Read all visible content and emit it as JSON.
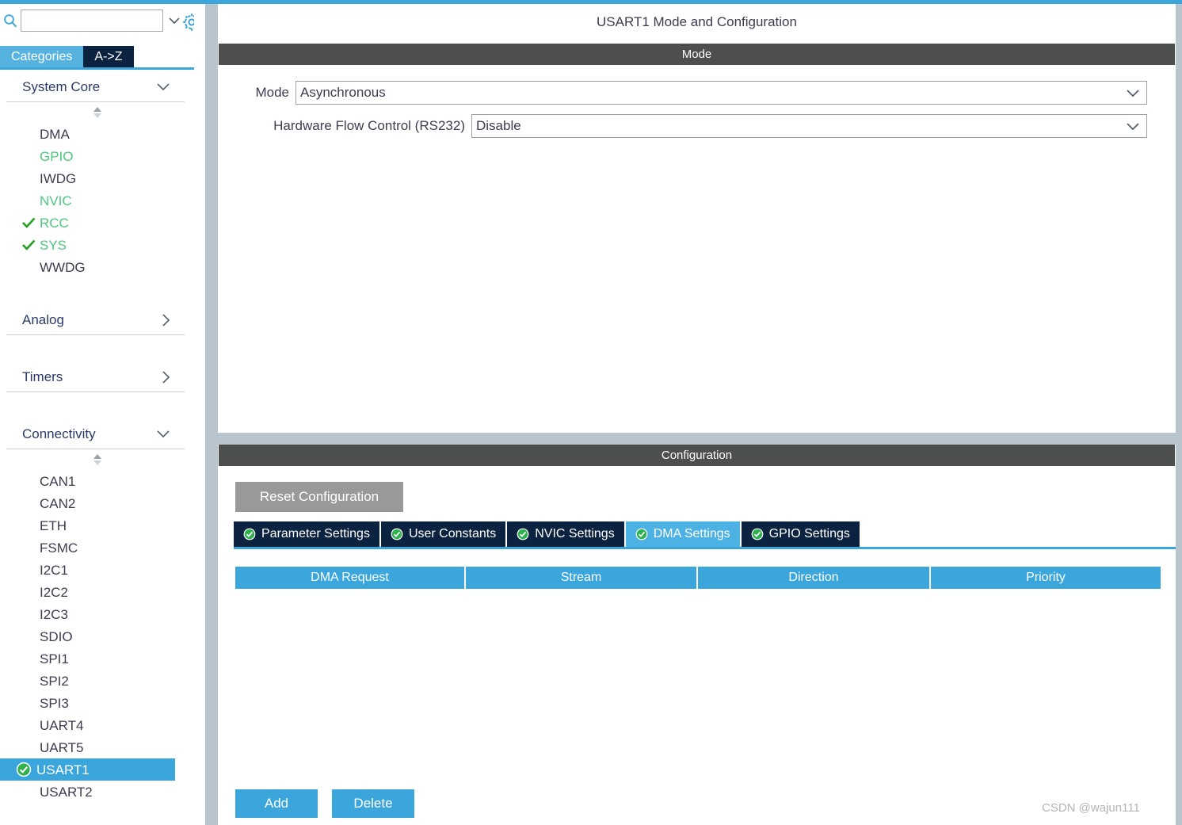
{
  "theme": {
    "accent_blue": "#3aa6dc",
    "tab_navy": "#0b2340",
    "active_tab_blue": "#4cb1e3",
    "dark_bar": "#4d4f4f",
    "splitter_gray": "#b9c5cc",
    "green_check": "#21a121",
    "green_label": "#4ec77e",
    "reset_gray": "#97999b"
  },
  "sidebar": {
    "search": {
      "value": "",
      "placeholder": "",
      "icon": "search-icon",
      "caret_icon": "chevron-down-icon"
    },
    "settings_icon": "gear-icon",
    "tabs": [
      {
        "label": "Categories",
        "active": true
      },
      {
        "label": "A->Z",
        "active": false
      }
    ],
    "groups": [
      {
        "title": "System Core",
        "expanded": true,
        "chevron": "chevron-down-icon",
        "items": [
          {
            "label": "DMA",
            "checked": false,
            "green": false
          },
          {
            "label": "GPIO",
            "checked": false,
            "green": true
          },
          {
            "label": "IWDG",
            "checked": false,
            "green": false
          },
          {
            "label": "NVIC",
            "checked": false,
            "green": true
          },
          {
            "label": "RCC",
            "checked": true,
            "green": true
          },
          {
            "label": "SYS",
            "checked": true,
            "green": true
          },
          {
            "label": "WWDG",
            "checked": false,
            "green": false
          }
        ]
      },
      {
        "title": "Analog",
        "expanded": false,
        "chevron": "chevron-right-icon",
        "items": []
      },
      {
        "title": "Timers",
        "expanded": false,
        "chevron": "chevron-right-icon",
        "items": []
      },
      {
        "title": "Connectivity",
        "expanded": true,
        "chevron": "chevron-down-icon",
        "items": [
          {
            "label": "CAN1",
            "checked": false,
            "green": false
          },
          {
            "label": "CAN2",
            "checked": false,
            "green": false
          },
          {
            "label": "ETH",
            "checked": false,
            "green": false
          },
          {
            "label": "FSMC",
            "checked": false,
            "green": false
          },
          {
            "label": "I2C1",
            "checked": false,
            "green": false
          },
          {
            "label": "I2C2",
            "checked": false,
            "green": false
          },
          {
            "label": "I2C3",
            "checked": false,
            "green": false
          },
          {
            "label": "SDIO",
            "checked": false,
            "green": false
          },
          {
            "label": "SPI1",
            "checked": false,
            "green": false
          },
          {
            "label": "SPI2",
            "checked": false,
            "green": false
          },
          {
            "label": "SPI3",
            "checked": false,
            "green": false
          },
          {
            "label": "UART4",
            "checked": false,
            "green": false
          },
          {
            "label": "UART5",
            "checked": false,
            "green": false
          },
          {
            "label": "USART1",
            "checked": false,
            "green": false,
            "selected": true,
            "badge": "circle-check-icon"
          },
          {
            "label": "USART2",
            "checked": false,
            "green": false
          }
        ]
      }
    ]
  },
  "main": {
    "title": "USART1 Mode and Configuration",
    "mode_section": {
      "header": "Mode",
      "fields": [
        {
          "label": "Mode",
          "value": "Asynchronous",
          "chevron": "chevron-down-icon"
        },
        {
          "label": "Hardware Flow Control (RS232)",
          "value": "Disable",
          "chevron": "chevron-down-icon"
        }
      ]
    },
    "config_section": {
      "header": "Configuration",
      "reset_label": "Reset Configuration",
      "tabs": [
        {
          "label": "Parameter Settings",
          "active": false,
          "icon": "circle-check-icon"
        },
        {
          "label": "User Constants",
          "active": false,
          "icon": "circle-check-icon"
        },
        {
          "label": "NVIC Settings",
          "active": false,
          "icon": "circle-check-icon"
        },
        {
          "label": "DMA Settings",
          "active": true,
          "icon": "circle-check-icon"
        },
        {
          "label": "GPIO Settings",
          "active": false,
          "icon": "circle-check-icon"
        }
      ],
      "table": {
        "columns": [
          "DMA Request",
          "Stream",
          "Direction",
          "Priority"
        ],
        "rows": []
      },
      "buttons": [
        {
          "label": "Add"
        },
        {
          "label": "Delete"
        }
      ]
    }
  },
  "watermark": "CSDN @wajun111"
}
